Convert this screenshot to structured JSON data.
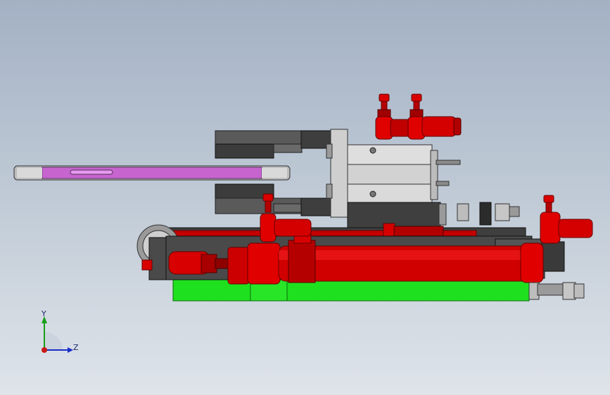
{
  "triad": {
    "y_label": "Y",
    "z_label": "Z"
  },
  "colors": {
    "background_top": "#a3b1c4",
    "background_bottom": "#dfe4ea",
    "fitting_red": "#d90000",
    "fitting_dark_red": "#8e0000",
    "base_green": "#1fe01f",
    "part_purple": "#c765cf",
    "body_gray": "#d7d7d7",
    "dark_gray": "#4a4a4a",
    "triad_y": "#1a9e1a",
    "triad_z": "#1a2ec8",
    "triad_x": "#c81a1a"
  }
}
